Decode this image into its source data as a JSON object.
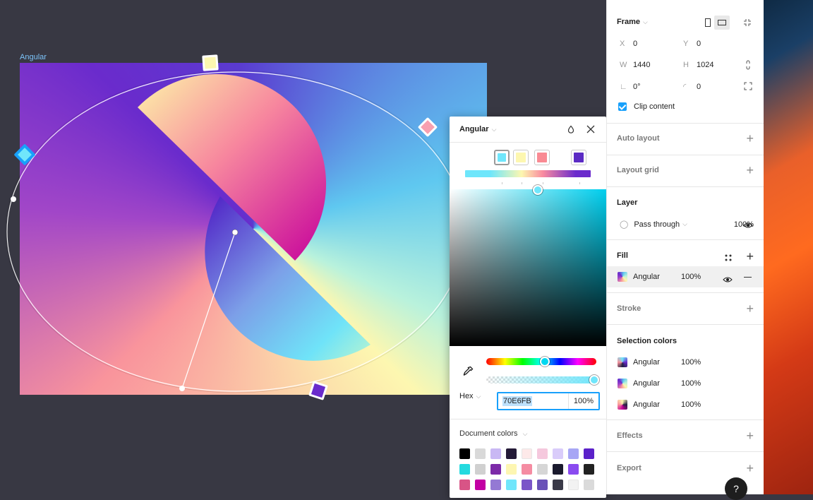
{
  "canvas": {
    "frame_label": "Angular"
  },
  "picker": {
    "title": "Angular",
    "stops": [
      {
        "color": "#70E6FB",
        "selected": true
      },
      {
        "color": "#FDF7B0",
        "selected": false
      },
      {
        "color": "#F98A93",
        "selected": false
      },
      {
        "color": "#5B2BC4",
        "selected": false
      }
    ],
    "hex_label": "Hex",
    "hex_value": "70E6FB",
    "opacity": "100%",
    "hue_level": 0.53,
    "alpha_level": 1.0,
    "doc_colors_label": "Document colors",
    "swatches": [
      "#000000",
      "#d9d9d9",
      "#c9b8f4",
      "#241a37",
      "#fde9e9",
      "#f5c8dd",
      "#d9ccfa",
      "#a7a6f5",
      "#5b21c9",
      "#25dadf",
      "#d0d0d0",
      "#7c2aa8",
      "#fdf6b2",
      "#f58ca2",
      "#d6d6d6",
      "#1a1a2e",
      "#8a4bf0",
      "#222222",
      "#d85486",
      "#c200a3",
      "#9479d4",
      "#70e6fb",
      "#7a55c8",
      "#6a52b8",
      "#3a3a48",
      "#f2f2f2",
      "#dadada"
    ]
  },
  "panel": {
    "frame": {
      "label": "Frame",
      "x_label": "X",
      "x": "0",
      "y_label": "Y",
      "y": "0",
      "w_label": "W",
      "w": "1440",
      "h_label": "H",
      "h": "1024",
      "rotation": "0°",
      "radius": "0",
      "clip_label": "Clip content"
    },
    "auto_layout": "Auto layout",
    "layout_grid": "Layout grid",
    "layer": {
      "label": "Layer",
      "blend": "Pass through",
      "opacity": "100%"
    },
    "fill": {
      "label": "Fill",
      "name": "Angular",
      "opacity": "100%"
    },
    "stroke": "Stroke",
    "selection_colors": {
      "label": "Selection colors",
      "items": [
        {
          "name": "Angular",
          "opacity": "100%"
        },
        {
          "name": "Angular",
          "opacity": "100%"
        },
        {
          "name": "Angular",
          "opacity": "100%"
        }
      ]
    },
    "effects": "Effects",
    "export": "Export"
  },
  "help": "?"
}
